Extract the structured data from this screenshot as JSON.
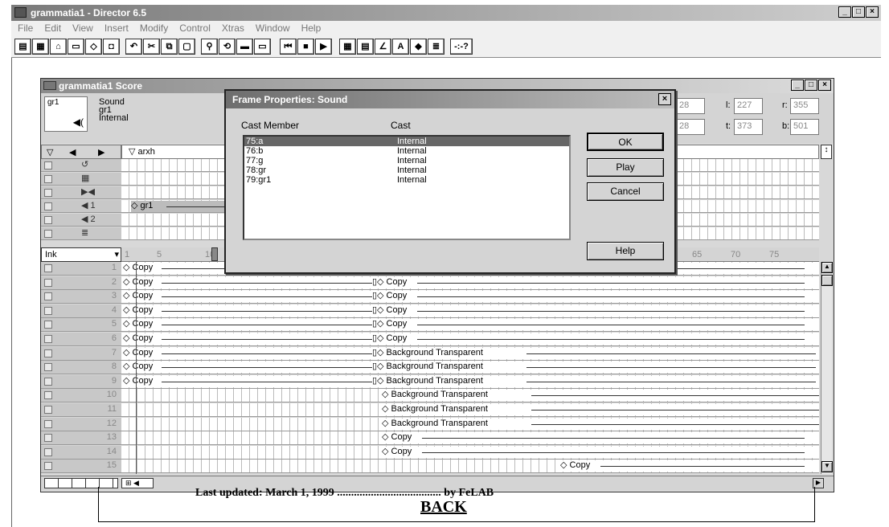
{
  "app": {
    "title": "grammatia1 - Director 6.5"
  },
  "menu": [
    "File",
    "Edit",
    "View",
    "Insert",
    "Modify",
    "Control",
    "Xtras",
    "Window",
    "Help"
  ],
  "toolbar": {
    "help_label": "-:-?"
  },
  "score": {
    "title": "grammatia1 Score",
    "sprite_name": "gr1",
    "sprite_type": "Sound",
    "sprite_member": "gr1",
    "sprite_cast": "Internal",
    "field_a": "28",
    "field_b": "28",
    "l_label": "l:",
    "l_value": "227",
    "r_label": "r:",
    "r_value": "355",
    "t_label": "t:",
    "t_value": "373",
    "b_label": "b:",
    "b_value": "501",
    "marker_label": "arxh",
    "ink_label": "Ink",
    "frame_ticks": [
      "1",
      "5",
      "10",
      "65",
      "70",
      "75"
    ],
    "sound1_sprite": "gr1",
    "special_channels": [
      {
        "icon": "tempo-icon",
        "glyph": "↺"
      },
      {
        "icon": "palette-icon",
        "glyph": "▦"
      },
      {
        "icon": "transition-icon",
        "glyph": "▶◀"
      },
      {
        "icon": "sound-1-icon",
        "glyph": "◀ 1"
      },
      {
        "icon": "sound-2-icon",
        "glyph": "◀ 2"
      },
      {
        "icon": "script-icon",
        "glyph": "≣"
      }
    ],
    "channels": [
      {
        "num": "1",
        "left": "Copy",
        "right": "Copy"
      },
      {
        "num": "2",
        "left": "Copy",
        "right": "Copy"
      },
      {
        "num": "3",
        "left": "Copy",
        "right": "Copy"
      },
      {
        "num": "4",
        "left": "Copy",
        "right": "Copy"
      },
      {
        "num": "5",
        "left": "Copy",
        "right": "Copy"
      },
      {
        "num": "6",
        "left": "Copy",
        "right": "Copy"
      },
      {
        "num": "7",
        "left": "Copy",
        "right": "Background Transparent"
      },
      {
        "num": "8",
        "left": "Copy",
        "right": "Background Transparent"
      },
      {
        "num": "9",
        "left": "Copy",
        "right": "Background Transparent"
      },
      {
        "num": "10",
        "left": "",
        "right": "Background Transparent"
      },
      {
        "num": "11",
        "left": "",
        "right": "Background Transparent"
      },
      {
        "num": "12",
        "left": "",
        "right": "Background Transparent"
      },
      {
        "num": "13",
        "left": "",
        "right": "Copy"
      },
      {
        "num": "14",
        "left": "",
        "right": "Copy"
      },
      {
        "num": "15",
        "left": "",
        "right": "Copy"
      }
    ]
  },
  "dialog": {
    "title": "Frame Properties: Sound",
    "col_member": "Cast Member",
    "col_cast": "Cast",
    "rows": [
      {
        "member": "75:a",
        "cast": "Internal"
      },
      {
        "member": "76:b",
        "cast": "Internal"
      },
      {
        "member": "77:g",
        "cast": "Internal"
      },
      {
        "member": "78:gr",
        "cast": "Internal"
      },
      {
        "member": "79:gr1",
        "cast": "Internal"
      }
    ],
    "ok_label": "OK",
    "play_label": "Play",
    "cancel_label": "Cancel",
    "help_label": "Help"
  },
  "page": {
    "last_updated": "Last updated: March 1, 1999 ..................................... by FeLAB",
    "back_link": "BACK"
  }
}
